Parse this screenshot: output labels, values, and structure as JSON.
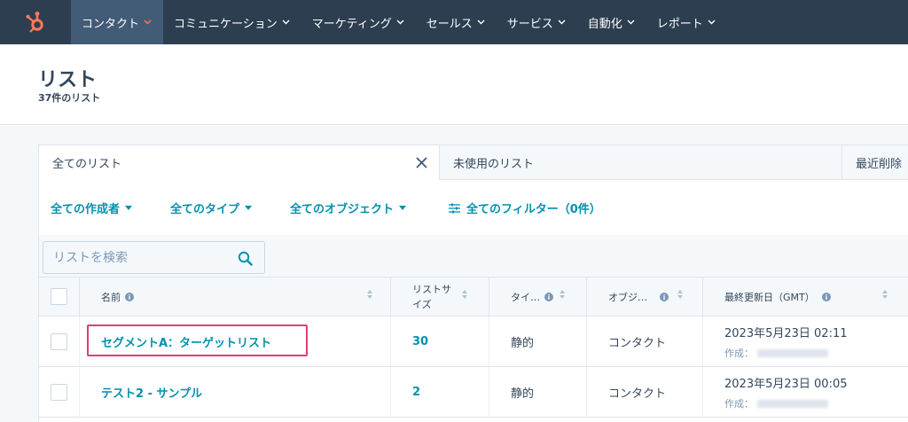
{
  "nav": {
    "items": [
      {
        "label": "コンタクト",
        "active": true
      },
      {
        "label": "コミュニケーション"
      },
      {
        "label": "マーケティング"
      },
      {
        "label": "セールス"
      },
      {
        "label": "サービス"
      },
      {
        "label": "自動化"
      },
      {
        "label": "レポート"
      }
    ]
  },
  "header": {
    "title": "リスト",
    "subtitle": "37件のリスト"
  },
  "tabs": {
    "all": "全てのリスト",
    "unused": "未使用のリスト",
    "deleted": "最近削除"
  },
  "filters": {
    "creator": "全ての作成者",
    "type": "全てのタイプ",
    "object": "全てのオブジェクト",
    "all_filters": "全てのフィルター（0件）"
  },
  "search": {
    "placeholder": "リストを検索"
  },
  "table": {
    "headers": {
      "name": "名前",
      "size_line1": "リストサ",
      "size_line2": "イズ",
      "type": "タイ…",
      "object": "オブジ…",
      "updated": "最終更新日（GMT）"
    },
    "rows": [
      {
        "name": "セグメントA：ターゲットリスト",
        "size": "30",
        "type": "静的",
        "object": "コンタクト",
        "updated": "2023年5月23日 02:11",
        "created_label": "作成："
      },
      {
        "name": "テスト2 - サンプル",
        "size": "2",
        "type": "静的",
        "object": "コンタクト",
        "updated": "2023年5月23日 00:05",
        "created_label": "作成："
      }
    ]
  },
  "colors": {
    "nav_bg": "#2d3e50",
    "accent": "#0091ae",
    "logo": "#ff7a59",
    "highlight": "#e03e75"
  },
  "icons": {
    "logo": "hubspot-sprocket-icon",
    "search": "search-icon",
    "close": "close-icon",
    "filter": "sliders-icon",
    "info": "info-icon"
  }
}
